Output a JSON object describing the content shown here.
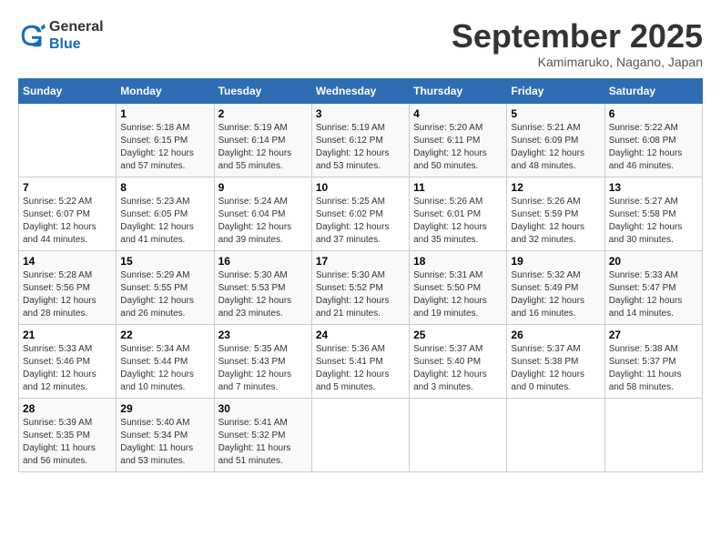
{
  "header": {
    "logo_general": "General",
    "logo_blue": "Blue",
    "month_title": "September 2025",
    "location": "Kamimaruko, Nagano, Japan"
  },
  "weekdays": [
    "Sunday",
    "Monday",
    "Tuesday",
    "Wednesday",
    "Thursday",
    "Friday",
    "Saturday"
  ],
  "weeks": [
    [
      {
        "day": "",
        "info": ""
      },
      {
        "day": "1",
        "info": "Sunrise: 5:18 AM\nSunset: 6:15 PM\nDaylight: 12 hours\nand 57 minutes."
      },
      {
        "day": "2",
        "info": "Sunrise: 5:19 AM\nSunset: 6:14 PM\nDaylight: 12 hours\nand 55 minutes."
      },
      {
        "day": "3",
        "info": "Sunrise: 5:19 AM\nSunset: 6:12 PM\nDaylight: 12 hours\nand 53 minutes."
      },
      {
        "day": "4",
        "info": "Sunrise: 5:20 AM\nSunset: 6:11 PM\nDaylight: 12 hours\nand 50 minutes."
      },
      {
        "day": "5",
        "info": "Sunrise: 5:21 AM\nSunset: 6:09 PM\nDaylight: 12 hours\nand 48 minutes."
      },
      {
        "day": "6",
        "info": "Sunrise: 5:22 AM\nSunset: 6:08 PM\nDaylight: 12 hours\nand 46 minutes."
      }
    ],
    [
      {
        "day": "7",
        "info": "Sunrise: 5:22 AM\nSunset: 6:07 PM\nDaylight: 12 hours\nand 44 minutes."
      },
      {
        "day": "8",
        "info": "Sunrise: 5:23 AM\nSunset: 6:05 PM\nDaylight: 12 hours\nand 41 minutes."
      },
      {
        "day": "9",
        "info": "Sunrise: 5:24 AM\nSunset: 6:04 PM\nDaylight: 12 hours\nand 39 minutes."
      },
      {
        "day": "10",
        "info": "Sunrise: 5:25 AM\nSunset: 6:02 PM\nDaylight: 12 hours\nand 37 minutes."
      },
      {
        "day": "11",
        "info": "Sunrise: 5:26 AM\nSunset: 6:01 PM\nDaylight: 12 hours\nand 35 minutes."
      },
      {
        "day": "12",
        "info": "Sunrise: 5:26 AM\nSunset: 5:59 PM\nDaylight: 12 hours\nand 32 minutes."
      },
      {
        "day": "13",
        "info": "Sunrise: 5:27 AM\nSunset: 5:58 PM\nDaylight: 12 hours\nand 30 minutes."
      }
    ],
    [
      {
        "day": "14",
        "info": "Sunrise: 5:28 AM\nSunset: 5:56 PM\nDaylight: 12 hours\nand 28 minutes."
      },
      {
        "day": "15",
        "info": "Sunrise: 5:29 AM\nSunset: 5:55 PM\nDaylight: 12 hours\nand 26 minutes."
      },
      {
        "day": "16",
        "info": "Sunrise: 5:30 AM\nSunset: 5:53 PM\nDaylight: 12 hours\nand 23 minutes."
      },
      {
        "day": "17",
        "info": "Sunrise: 5:30 AM\nSunset: 5:52 PM\nDaylight: 12 hours\nand 21 minutes."
      },
      {
        "day": "18",
        "info": "Sunrise: 5:31 AM\nSunset: 5:50 PM\nDaylight: 12 hours\nand 19 minutes."
      },
      {
        "day": "19",
        "info": "Sunrise: 5:32 AM\nSunset: 5:49 PM\nDaylight: 12 hours\nand 16 minutes."
      },
      {
        "day": "20",
        "info": "Sunrise: 5:33 AM\nSunset: 5:47 PM\nDaylight: 12 hours\nand 14 minutes."
      }
    ],
    [
      {
        "day": "21",
        "info": "Sunrise: 5:33 AM\nSunset: 5:46 PM\nDaylight: 12 hours\nand 12 minutes."
      },
      {
        "day": "22",
        "info": "Sunrise: 5:34 AM\nSunset: 5:44 PM\nDaylight: 12 hours\nand 10 minutes."
      },
      {
        "day": "23",
        "info": "Sunrise: 5:35 AM\nSunset: 5:43 PM\nDaylight: 12 hours\nand 7 minutes."
      },
      {
        "day": "24",
        "info": "Sunrise: 5:36 AM\nSunset: 5:41 PM\nDaylight: 12 hours\nand 5 minutes."
      },
      {
        "day": "25",
        "info": "Sunrise: 5:37 AM\nSunset: 5:40 PM\nDaylight: 12 hours\nand 3 minutes."
      },
      {
        "day": "26",
        "info": "Sunrise: 5:37 AM\nSunset: 5:38 PM\nDaylight: 12 hours\nand 0 minutes."
      },
      {
        "day": "27",
        "info": "Sunrise: 5:38 AM\nSunset: 5:37 PM\nDaylight: 11 hours\nand 58 minutes."
      }
    ],
    [
      {
        "day": "28",
        "info": "Sunrise: 5:39 AM\nSunset: 5:35 PM\nDaylight: 11 hours\nand 56 minutes."
      },
      {
        "day": "29",
        "info": "Sunrise: 5:40 AM\nSunset: 5:34 PM\nDaylight: 11 hours\nand 53 minutes."
      },
      {
        "day": "30",
        "info": "Sunrise: 5:41 AM\nSunset: 5:32 PM\nDaylight: 11 hours\nand 51 minutes."
      },
      {
        "day": "",
        "info": ""
      },
      {
        "day": "",
        "info": ""
      },
      {
        "day": "",
        "info": ""
      },
      {
        "day": "",
        "info": ""
      }
    ]
  ]
}
